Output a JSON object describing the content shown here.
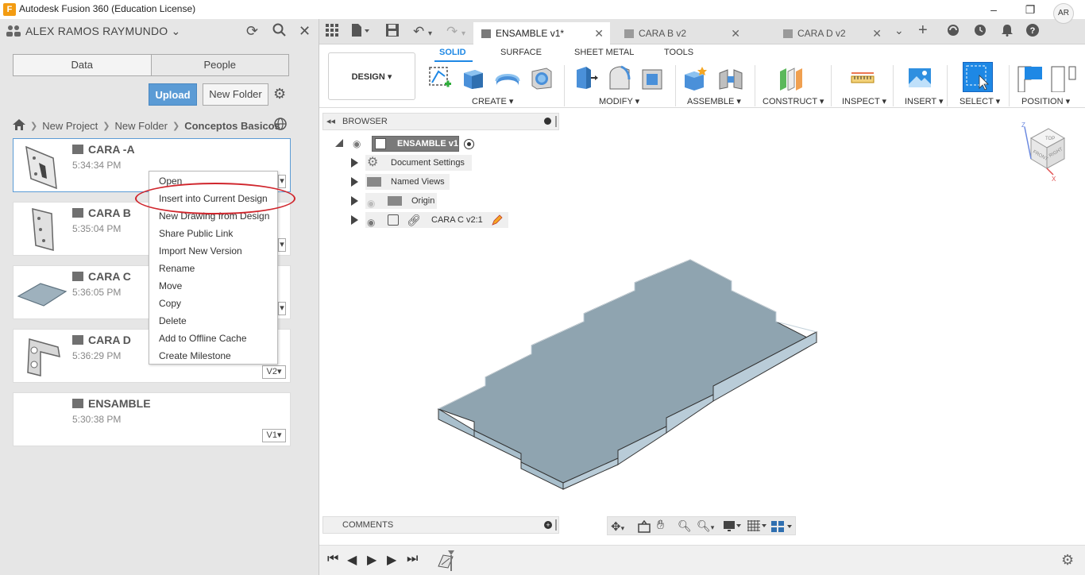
{
  "window": {
    "title": "Autodesk Fusion 360 (Education License)",
    "logo_letter": "F",
    "controls": {
      "minimize": "–",
      "maximize": "❐",
      "close": "✕"
    }
  },
  "data_panel": {
    "user_name": "ALEX RAMOS RAYMUNDO",
    "tabs": [
      "Data",
      "People"
    ],
    "upload_label": "Upload",
    "new_folder_label": "New Folder",
    "breadcrumb": [
      "New Project",
      "New Folder",
      "Conceptos Basicos"
    ],
    "files": [
      {
        "name": "CARA -A",
        "time": "5:34:34 PM",
        "version": ""
      },
      {
        "name": "CARA B",
        "time": "5:35:04 PM",
        "version": ""
      },
      {
        "name": "CARA C",
        "time": "5:36:05 PM",
        "version": ""
      },
      {
        "name": "CARA D",
        "time": "5:36:29 PM",
        "version": "V2▾"
      },
      {
        "name": "ENSAMBLE",
        "time": "5:30:38 PM",
        "version": "V1▾"
      }
    ]
  },
  "context_menu": {
    "items": [
      "Open",
      "Insert into Current Design",
      "New Drawing from Design",
      "Share Public Link",
      "Import New Version",
      "Rename",
      "Move",
      "Copy",
      "Delete",
      "Add to Offline Cache",
      "Create Milestone"
    ],
    "highlighted_index": 1
  },
  "doc_tabs": [
    {
      "label": "ENSAMBLE v1*",
      "active": true
    },
    {
      "label": "CARA B v2",
      "active": false
    },
    {
      "label": "CARA D v2",
      "active": false
    }
  ],
  "toolbar": {
    "workspace_button": "DESIGN ▾",
    "workspace_tabs": [
      "SOLID",
      "SURFACE",
      "SHEET METAL",
      "TOOLS"
    ],
    "groups": [
      "CREATE ▾",
      "MODIFY ▾",
      "ASSEMBLE ▾",
      "CONSTRUCT ▾",
      "INSPECT ▾",
      "INSERT ▾",
      "SELECT ▾",
      "POSITION ▾"
    ]
  },
  "browser": {
    "title": "BROWSER",
    "root": "ENSAMBLE v1",
    "nodes": [
      "Document Settings",
      "Named Views",
      "Origin",
      "CARA C v2:1"
    ]
  },
  "comments_label": "COMMENTS",
  "avatar_initials": "AR",
  "viewcube": {
    "top": "TOP",
    "front": "FRONT",
    "right": "RIGHT",
    "z": "Z",
    "x": "X"
  },
  "colors": {
    "accent": "#1e88e5",
    "upload_button": "#5b9bd5",
    "highlight_circle": "#d0262d",
    "part_fill": "#8fa4b0",
    "part_edge": "#a9bfcc"
  }
}
